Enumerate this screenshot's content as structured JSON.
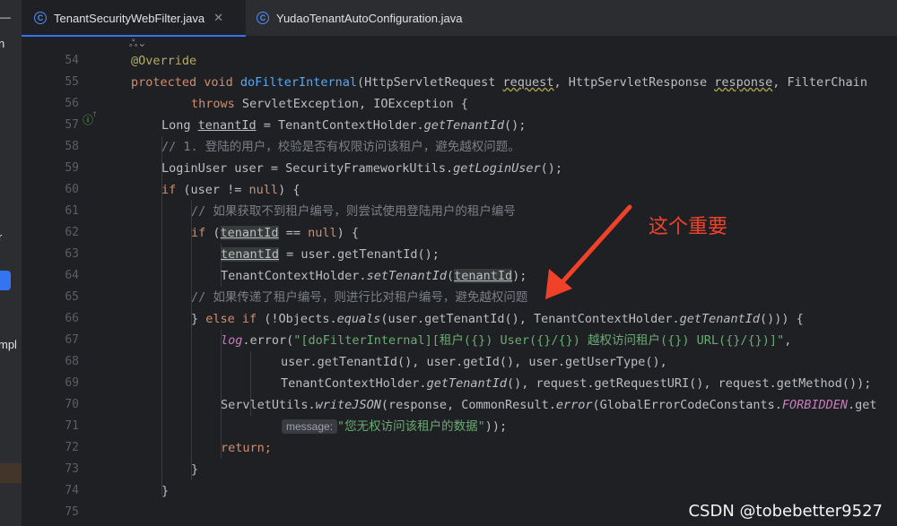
{
  "tabs": [
    {
      "label": "TenantSecurityWebFilter.java",
      "icon": "class-icon",
      "icon_letter": "C",
      "close": "✕",
      "active": true
    },
    {
      "label": "YudaoTenantAutoConfiguration.java",
      "icon": "class-icon",
      "icon_letter": "C",
      "active": false
    }
  ],
  "sidebar": {
    "fragments": [
      "n",
      "r",
      "mpl"
    ]
  },
  "fold_hint": "ஃ⌄",
  "line_numbers": [
    "54",
    "55",
    "56",
    "57",
    "58",
    "59",
    "60",
    "61",
    "62",
    "63",
    "64",
    "65",
    "66",
    "67",
    "68",
    "69",
    "70",
    "71",
    "72",
    "73",
    "74",
    "75"
  ],
  "code": {
    "l54": "@Override",
    "l55_kw": "protected void ",
    "l55_fn": "doFilterInternal",
    "l55_a": "(HttpServletRequest ",
    "l55_p1": "request",
    "l55_b": ", HttpServletResponse ",
    "l55_p2": "response",
    "l55_c": ", FilterChain",
    "l56_kw": "throws ",
    "l56_rest": "ServletException, IOException {",
    "l57_a": "Long ",
    "l57_var": "tenantId",
    "l57_b": " = TenantContextHolder.",
    "l57_m": "getTenantId",
    "l57_c": "();",
    "l58": "// 1. 登陆的用户，校验是否有权限访问该租户，避免越权问题。",
    "l59_a": "LoginUser user = SecurityFrameworkUtils.",
    "l59_m": "getLoginUser",
    "l59_c": "();",
    "l60_kw": "if ",
    "l60_a": "(user != ",
    "l60_kw2": "null",
    "l60_b": ") {",
    "l61": "// 如果获取不到租户编号，则尝试使用登陆用户的租户编号",
    "l62_kw": "if ",
    "l62_a": "(",
    "l62_var": "tenantId",
    "l62_b": " == ",
    "l62_kw2": "null",
    "l62_c": ") {",
    "l63_var": "tenantId",
    "l63_a": " = user.getTenantId();",
    "l64_a": "TenantContextHolder.",
    "l64_m": "setTenantId",
    "l64_b": "(",
    "l64_var": "tenantId",
    "l64_c": ");",
    "l65": "// 如果传递了租户编号，则进行比对租户编号，避免越权问题",
    "l66_a": "} ",
    "l66_kw": "else if ",
    "l66_b": "(!Objects.",
    "l66_m": "equals",
    "l66_c": "(user.getTenantId(), TenantContextHolder.",
    "l66_m2": "getTenantId",
    "l66_d": "())) {",
    "l67_log": "log",
    "l67_a": ".error(",
    "l67_str": "\"[doFilterInternal][租户({}) User({}/{}) 越权访问租户({}) URL({}/{})]\"",
    "l67_b": ",",
    "l68": "user.getTenantId(), user.getId(), user.getUserType(),",
    "l69_a": "TenantContextHolder.",
    "l69_m": "getTenantId",
    "l69_b": "(), request.getRequestURI(), request.getMethod());",
    "l70_a": "ServletUtils.",
    "l70_m": "writeJSON",
    "l70_b": "(response, CommonResult.",
    "l70_m2": "error",
    "l70_c": "(GlobalErrorCodeConstants.",
    "l70_f": "FORBIDDEN",
    "l70_d": ".get",
    "l71_hint": "message:",
    "l71_str": "\"您无权访问该租户的数据\"",
    "l71_b": "));",
    "l72": "return;",
    "l73": "}",
    "l74": "}"
  },
  "annotation": "这个重要",
  "annotation_color": "#f0422a",
  "watermark": "CSDN @tobebetter9527",
  "colors": {
    "keyword": "#cf8e6d",
    "function": "#56a8f5",
    "comment": "#7a7e85",
    "string": "#6aab73",
    "annotation": "#b3ae60",
    "field": "#c77dbb",
    "accent": "#3574f0"
  }
}
